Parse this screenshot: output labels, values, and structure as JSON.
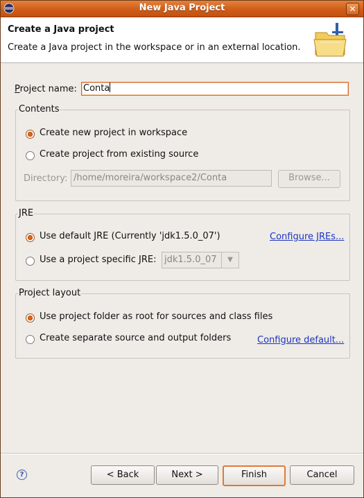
{
  "window": {
    "title": "New Java Project",
    "close_glyph": "✕"
  },
  "banner": {
    "title": "Create a Java project",
    "description": "Create a Java project in the workspace or in an external location."
  },
  "form": {
    "project_name_label": "Project name:",
    "project_name_value": "Conta"
  },
  "contents": {
    "label": "Contents",
    "option_new": "Create new project in workspace",
    "option_existing": "Create project from existing source",
    "directory_label": "Directory:",
    "directory_value": "/home/moreira/workspace2/Conta",
    "browse_label": "Browse..."
  },
  "jre": {
    "label": "JRE",
    "option_default": "Use default JRE (Currently 'jdk1.5.0_07')",
    "option_specific": "Use a project specific JRE:",
    "specific_value": "jdk1.5.0_07",
    "configure_link": "Configure JREs..."
  },
  "layout": {
    "label": "Project layout",
    "option_root": "Use project folder as root for sources and class files",
    "option_separate": "Create separate source and output folders",
    "configure_link": "Configure default..."
  },
  "buttons": {
    "back": "< Back",
    "next": "Next >",
    "finish": "Finish",
    "cancel": "Cancel",
    "help": "?"
  },
  "colors": {
    "titlebar": "#cf5d17",
    "accent_radio": "#e06717",
    "link": "#1a35c2"
  },
  "icons": [
    "eclipse-app-icon",
    "close-icon",
    "java-folder-icon",
    "help-icon",
    "chevron-down-icon"
  ]
}
